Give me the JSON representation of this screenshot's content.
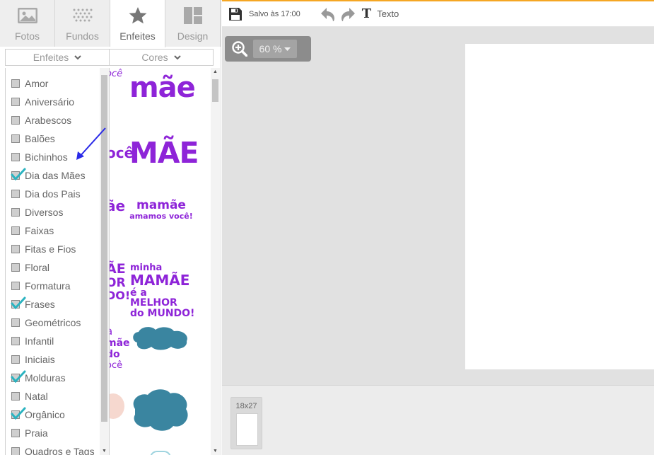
{
  "tabs": [
    {
      "label": "Fotos",
      "icon": "photo-icon"
    },
    {
      "label": "Fundos",
      "icon": "pattern-icon"
    },
    {
      "label": "Enfeites",
      "icon": "star-icon"
    },
    {
      "label": "Design",
      "icon": "layout-icon"
    }
  ],
  "active_tab": "Enfeites",
  "filters": {
    "category_label": "Enfeites",
    "color_label": "Cores"
  },
  "categories": [
    {
      "label": "Amor",
      "checked": false
    },
    {
      "label": "Aniversário",
      "checked": false
    },
    {
      "label": "Arabescos",
      "checked": false
    },
    {
      "label": "Balões",
      "checked": false
    },
    {
      "label": "Bichinhos",
      "checked": false
    },
    {
      "label": "Dia das Mães",
      "checked": true
    },
    {
      "label": "Dia dos Pais",
      "checked": false
    },
    {
      "label": "Diversos",
      "checked": false
    },
    {
      "label": "Faixas",
      "checked": false
    },
    {
      "label": "Fitas e Fios",
      "checked": false
    },
    {
      "label": "Floral",
      "checked": false
    },
    {
      "label": "Formatura",
      "checked": false
    },
    {
      "label": "Frases",
      "checked": true
    },
    {
      "label": "Geométricos",
      "checked": false
    },
    {
      "label": "Infantil",
      "checked": false
    },
    {
      "label": "Iniciais",
      "checked": false
    },
    {
      "label": "Molduras",
      "checked": true
    },
    {
      "label": "Natal",
      "checked": false
    },
    {
      "label": "Orgânico",
      "checked": true
    },
    {
      "label": "Praia",
      "checked": false
    },
    {
      "label": "Quadros e Tags",
      "checked": false
    }
  ],
  "stickers": {
    "mae_lower": "mãe",
    "mae_upper": "MÃE",
    "mamae_line1": "mamãe",
    "mamae_line2": "amamos você!",
    "minha_line1": "minha",
    "minha_line2": "MAMÃE",
    "minha_line3": "é a MELHOR",
    "minha_line4": "do MUNDO!",
    "partial_voce_1": "ocê",
    "partial_voce_2": "ocê",
    "partial_mae": "ãe",
    "partial_mae2": "ÃE",
    "partial_or": "OR",
    "partial_do": "DO!",
    "partial_a": "a",
    "partial_mae3": "mãe",
    "partial_do2": "do",
    "partial_voce_3": "ocê"
  },
  "toolbar": {
    "saved_text": "Salvo às 17:00",
    "text_tool_label": "Texto",
    "text_tool_glyph": "T"
  },
  "zoom": {
    "value": "60 %"
  },
  "pages": [
    {
      "size_label": "18x27"
    }
  ],
  "colors": {
    "accent_orange": "#f5a623",
    "sticker_purple": "#8e24d8",
    "cloud_teal": "#3a85a0",
    "check_teal": "#2bb3c0",
    "arrow_blue": "#2a2ae8"
  }
}
